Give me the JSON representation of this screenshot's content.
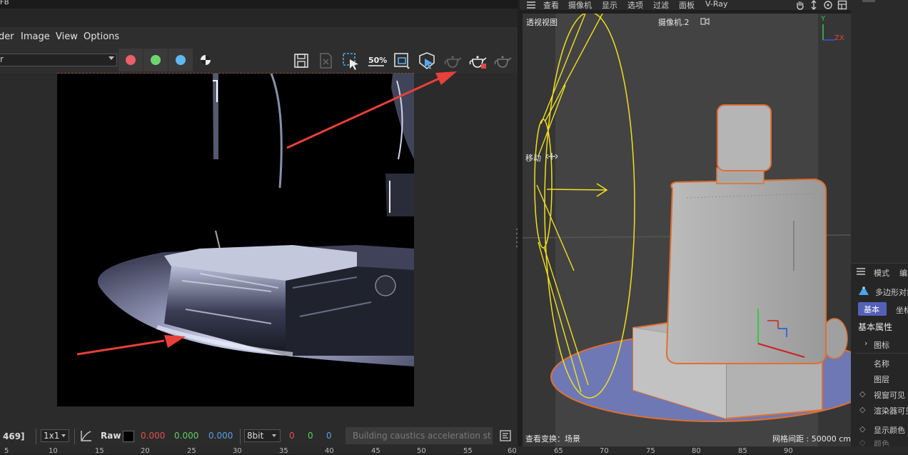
{
  "vfb": {
    "title": "FB",
    "menu": [
      "der",
      "Image",
      "View",
      "Options"
    ],
    "channel_value": "r",
    "colors": {
      "red": "#ea5f6a",
      "green": "#6ed56e",
      "blue": "#60b9ec"
    },
    "toolbar_icons": [
      "save-icon",
      "clear-icon",
      "region-select-icon",
      "zoom-50-icon",
      "region-render-icon",
      "track-mouse-icon",
      "render-disabled-icon",
      "render-icon",
      "render-interactive-icon"
    ],
    "zoom_badge": "50%",
    "bottom": {
      "coord": "469]",
      "zoom": "1x1",
      "raw": "Raw",
      "rgb": [
        "0.000",
        "0.000",
        "0.000"
      ],
      "bit_depth": "8bit",
      "rgb_int": [
        "0",
        "0",
        "0"
      ],
      "status": "Building caustics acceleration str"
    }
  },
  "ruler": [
    "5",
    "10",
    "15",
    "20",
    "25",
    "30",
    "35",
    "40",
    "45",
    "50",
    "55",
    "60",
    "65",
    "70",
    "75",
    "80",
    "85",
    "90"
  ],
  "viewport": {
    "menu": [
      "查看",
      "摄像机",
      "显示",
      "选项",
      "过滤",
      "面板",
      "V-Ray"
    ],
    "view_label": "透视视图",
    "camera_label": "摄像机.2",
    "move_label": "移动",
    "transform_label": "查看变换：场景",
    "grid_label": "网格间距 : 50000 cm",
    "axis": {
      "y": "Y",
      "zx": "ZX"
    }
  },
  "attributes": {
    "mode_tabs": [
      "模式",
      "编"
    ],
    "object_label": "多边形对象",
    "tabs": [
      "基本",
      "坐标"
    ],
    "section": "基本属性",
    "rows": [
      "图标",
      "名称",
      "图层",
      "视窗可见",
      "渲染器可见",
      "显示颜色",
      "颜色"
    ]
  },
  "colors": {
    "highlight": "#e07030",
    "camera": "#f0e020",
    "accent": "#5561b8"
  }
}
